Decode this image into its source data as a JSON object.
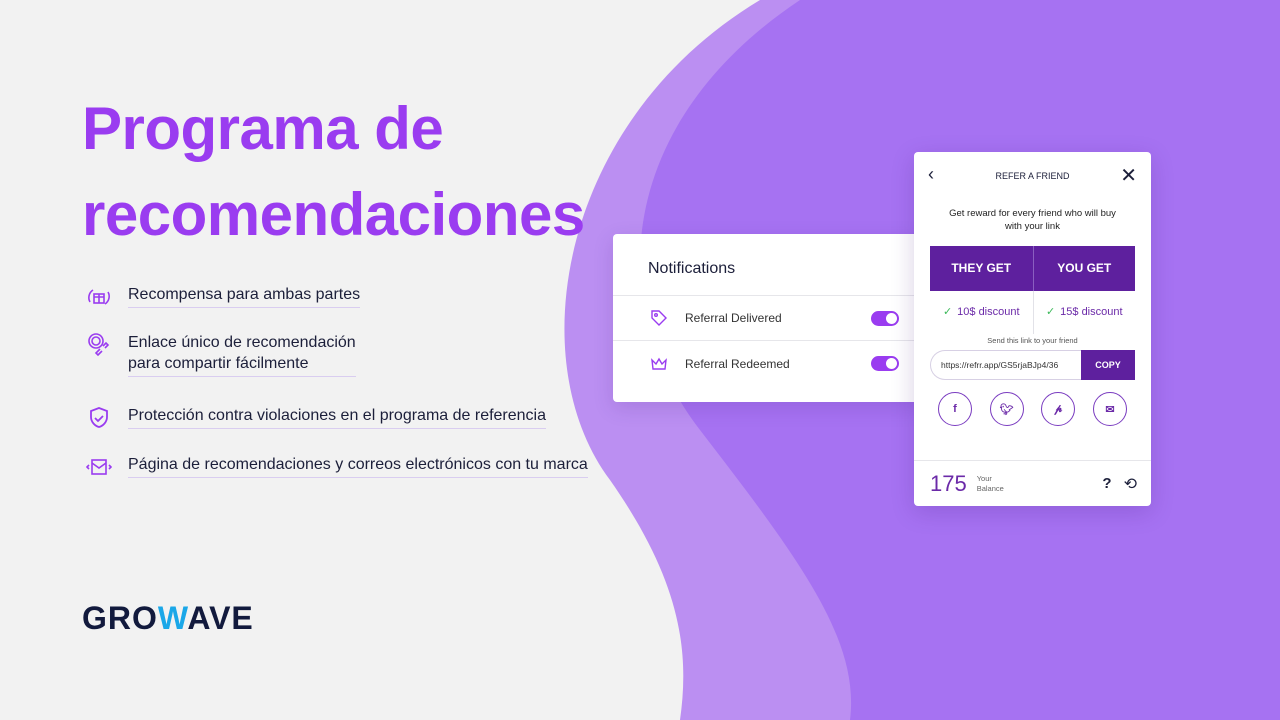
{
  "hero": {
    "title_line1": "Programa de",
    "title_line2": "recomendaciones"
  },
  "features": [
    {
      "icon": "gift-cycle-icon",
      "text": "Recompensa para ambas partes"
    },
    {
      "icon": "fingerprint-link-icon",
      "line1": "Enlace único de recomendación",
      "line2": "para compartir fácilmente"
    },
    {
      "icon": "shield-check-icon",
      "text": "Protección contra violaciones en el programa de referencia"
    },
    {
      "icon": "branded-email-icon",
      "text": "Página de recomendaciones y correos electrónicos con tu marca"
    }
  ],
  "logo": {
    "part1": "GRO",
    "part2": "W",
    "part3": "AVE",
    "color_dark": "#121a3d",
    "color_accent": "#1aa7e8"
  },
  "notifications": {
    "title": "Notifications",
    "items": [
      {
        "icon": "tag-icon",
        "label": "Referral Delivered",
        "enabled": true
      },
      {
        "icon": "crown-icon",
        "label": "Referral Redeemed",
        "enabled": true
      }
    ]
  },
  "refer": {
    "title": "REFER A FRIEND",
    "back_icon": "chevron-left-icon",
    "close_icon": "close-icon",
    "description_line1": "Get reward for every friend who will buy",
    "description_line2": "with your link",
    "they_get": "THEY GET",
    "you_get": "YOU GET",
    "they_value": "10$ discount",
    "you_value": "15$ discount",
    "send_label": "Send this link to your friend",
    "link": "https://refrr.app/GS5rjaBJp4/36",
    "copy": "COPY",
    "social": [
      "facebook-icon",
      "twitter-icon",
      "pinterest-icon",
      "email-icon"
    ],
    "balance": "175",
    "balance_label_1": "Your",
    "balance_label_2": "Balance",
    "help": "?"
  },
  "colors": {
    "accent": "#9a3cf0",
    "button": "#5e209e",
    "blob_light": "#bb8ff2",
    "blob_dark": "#a672f2",
    "background": "#f2f2f2"
  }
}
